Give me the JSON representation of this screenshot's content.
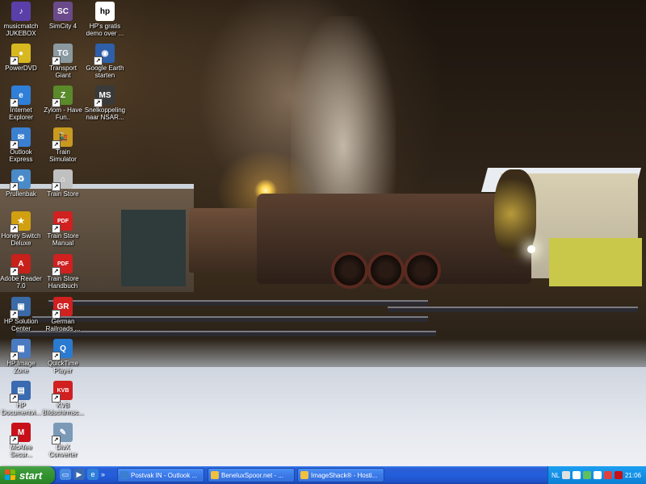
{
  "desktop": {
    "icons": [
      {
        "label": "musicmatch JUKEBOX",
        "icon": "musicmatch-jukebox-icon",
        "color": "#5a3fa8",
        "glyph": "♪"
      },
      {
        "label": "SimCity 4",
        "icon": "simcity-4-icon",
        "color": "#6a4a8a",
        "glyph": "SC"
      },
      {
        "label": "HP's gratis demo over ...",
        "icon": "hp-demo-icon",
        "color": "#ffffff",
        "glyph": "hp"
      },
      {
        "label": "PowerDVD",
        "icon": "powerdvd-icon",
        "color": "#d8b820",
        "glyph": "●"
      },
      {
        "label": "Transport Giant",
        "icon": "transport-giant-icon",
        "color": "#8a9aa0",
        "glyph": "TG"
      },
      {
        "label": "Google Earth starten",
        "icon": "google-earth-icon",
        "color": "#2e5fa8",
        "glyph": "◉"
      },
      {
        "label": "Internet Explorer",
        "icon": "internet-explorer-icon",
        "color": "#2f7fd8",
        "glyph": "e"
      },
      {
        "label": "Zylom - Have Fun..",
        "icon": "zylom-icon",
        "color": "#5a8a2a",
        "glyph": "Z"
      },
      {
        "label": "Snelkoppeling naar NSAR...",
        "icon": "msts-shortcut-icon",
        "color": "#3a3a3a",
        "glyph": "MS"
      },
      {
        "label": "Outlook Express",
        "icon": "outlook-express-icon",
        "color": "#3a7fd0",
        "glyph": "✉"
      },
      {
        "label": "Train Simulator",
        "icon": "train-simulator-icon",
        "color": "#c89a20",
        "glyph": "🚂"
      },
      {
        "label": "Prullenbak",
        "icon": "recycle-bin-icon",
        "color": "#4a8ac8",
        "glyph": "♻"
      },
      {
        "label": "Train Store",
        "icon": "train-store-icon",
        "color": "#c0c0c0",
        "glyph": "⌂"
      },
      {
        "label": "Honey Switch Deluxe",
        "icon": "honey-switch-icon",
        "color": "#d0a010",
        "glyph": "★"
      },
      {
        "label": "Train Store Manual",
        "icon": "train-store-manual-icon",
        "color": "#d02020",
        "glyph": "PDF"
      },
      {
        "label": "Adobe Reader 7.0",
        "icon": "adobe-reader-icon",
        "color": "#c8201a",
        "glyph": "A"
      },
      {
        "label": "Train Store Handbuch",
        "icon": "train-store-handbuch-icon",
        "color": "#d02020",
        "glyph": "PDF"
      },
      {
        "label": "HP Solution Center",
        "icon": "hp-solution-center-icon",
        "color": "#3a6aa8",
        "glyph": "▣"
      },
      {
        "label": "German Railroads ...",
        "icon": "german-railroads-icon",
        "color": "#d02020",
        "glyph": "GR"
      },
      {
        "label": "HP Image Zone",
        "icon": "hp-image-zone-icon",
        "color": "#4a7ac0",
        "glyph": "▦"
      },
      {
        "label": "QuickTime Player",
        "icon": "quicktime-icon",
        "color": "#2a7ad0",
        "glyph": "Q"
      },
      {
        "label": "HP Documentvi...",
        "icon": "hp-document-viewer-icon",
        "color": "#3a6ab0",
        "glyph": "▤"
      },
      {
        "label": "KVB Bildschirmsc...",
        "icon": "kvb-screensaver-icon",
        "color": "#d02020",
        "glyph": "KVB"
      },
      {
        "label": "McAfee Secur...",
        "icon": "mcafee-security-icon",
        "color": "#c8101a",
        "glyph": "M"
      },
      {
        "label": "DivX Converter",
        "icon": "divx-converter-icon",
        "color": "#7a9ab8",
        "glyph": "✎"
      }
    ]
  },
  "taskbar": {
    "start_label": "start",
    "quick_launch": [
      {
        "icon": "show-desktop-icon",
        "color": "#4a8ae0",
        "glyph": "▭"
      },
      {
        "icon": "windows-media-icon",
        "color": "#3a6ab0",
        "glyph": "▶"
      },
      {
        "icon": "ie-quick-icon",
        "color": "#2f7fd8",
        "glyph": "e"
      }
    ],
    "quick_launch_more": "»",
    "tasks": [
      {
        "label": "Postvak IN - Outlook ...",
        "icon": "outlook-task-icon",
        "color": "#3a7fd0"
      },
      {
        "label": "BeneluxSpoor.net - ...",
        "icon": "ie-task-icon",
        "color": "#f0c040"
      },
      {
        "label": "ImageShack® - Hosti...",
        "icon": "ie-task-icon",
        "color": "#f0c040"
      }
    ],
    "tray": {
      "language": "NL",
      "clock": "21:06",
      "icons": [
        {
          "icon": "keyboard-icon",
          "color": "#e0e0e0"
        },
        {
          "icon": "back-arrow-icon",
          "color": "#ffffff"
        },
        {
          "icon": "network-icon",
          "color": "#60c060"
        },
        {
          "icon": "volume-icon",
          "color": "#ffffff"
        },
        {
          "icon": "security-icon",
          "color": "#e04040"
        },
        {
          "icon": "mcafee-tray-icon",
          "color": "#c8101a"
        }
      ]
    }
  }
}
